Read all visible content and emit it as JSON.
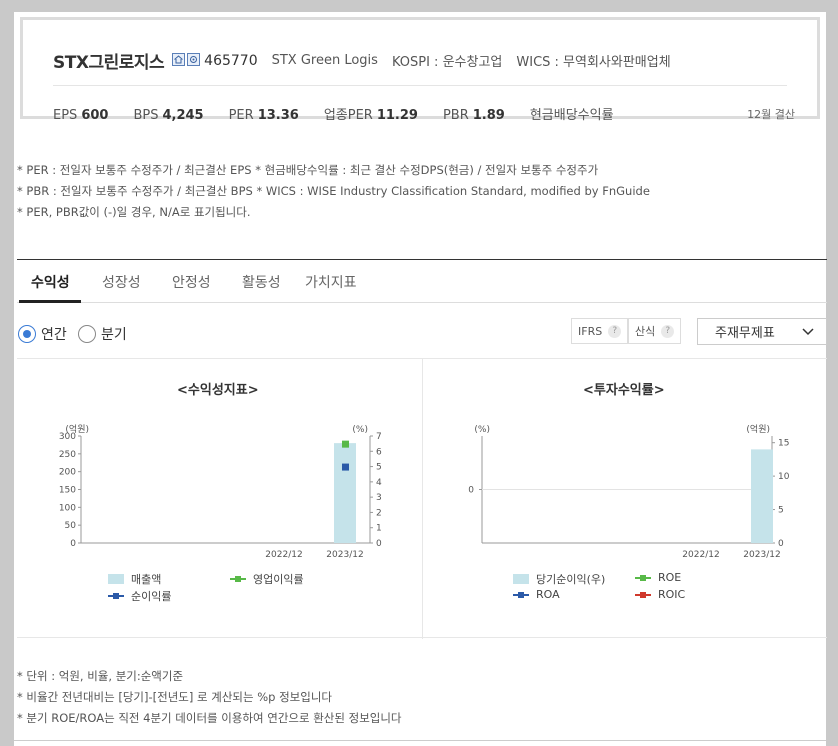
{
  "header": {
    "company": "STX그린로지스",
    "code": "465770",
    "english_name": "STX Green Logis",
    "market": "KOSPI : 운수창고업",
    "wics": "WICS : 무역회사와판매업체",
    "icons": [
      "home-icon",
      "ir-icon"
    ],
    "metrics": [
      {
        "label": "EPS",
        "value": "600"
      },
      {
        "label": "BPS",
        "value": "4,245"
      },
      {
        "label": "PER",
        "value": "13.36"
      },
      {
        "label": "업종PER",
        "value": "11.29"
      },
      {
        "label": "PBR",
        "value": "1.89"
      },
      {
        "label": "현금배당수익률",
        "value": ""
      }
    ],
    "fiscal": "12월 결산"
  },
  "notes_top": [
    "* PER : 전일자 보통주 수정주가 / 최근결산 EPS * 현금배당수익률 : 최근 결산 수정DPS(현금) / 전일자 보통주 수정주가",
    "* PBR : 전일자 보통주 수정주가 / 최근결산 BPS * WICS : WISE Industry Classification Standard, modified by FnGuide",
    "* PER, PBR값이 (-)일 경우, N/A로 표기됩니다."
  ],
  "tabs": [
    "수익성",
    "성장성",
    "안정성",
    "활동성",
    "가치지표"
  ],
  "period": {
    "annual": "연간",
    "quarter": "분기",
    "selected": "연간"
  },
  "controls": {
    "ifrs": "IFRS",
    "formula": "산식",
    "help": "?",
    "statement": "주재무제표"
  },
  "notes_bottom": [
    "* 단위 : 억원, 비율, 분기:순액기준",
    "* 비율간 전년대비는 [당기]-[전년도] 로 계산되는 %p 정보입니다",
    "* 분기 ROE/ROA는 직전 4분기 데이터를 이용하여 연간으로 환산된 정보입니다"
  ],
  "colors": {
    "bar": "#c5e3ea",
    "green": "#58b948",
    "blue": "#2b5aa8",
    "red": "#d0392c",
    "accent": "#3a7bd5"
  },
  "chart_data": [
    {
      "type": "bar",
      "title": "<수익성지표>",
      "left_unit": "(억원)",
      "right_unit": "(%)",
      "categories": [
        "2022/12",
        "2023/12"
      ],
      "left_ticks": [
        "300",
        "250",
        "200",
        "150",
        "100",
        "50",
        "0"
      ],
      "right_ticks": [
        "7",
        "6",
        "5",
        "4",
        "3",
        "2",
        "1",
        "0"
      ],
      "ylim_left": [
        0,
        300
      ],
      "ylim_right": [
        0,
        7
      ],
      "series": [
        {
          "name": "매출액",
          "axis": "left",
          "kind": "bar",
          "values": [
            null,
            280
          ]
        },
        {
          "name": "영업이익률",
          "axis": "right",
          "kind": "line",
          "values": [
            null,
            6.5
          ]
        },
        {
          "name": "순이익률",
          "axis": "right",
          "kind": "line",
          "values": [
            null,
            5.0
          ]
        }
      ]
    },
    {
      "type": "bar",
      "title": "<투자수익률>",
      "left_unit": "(%)",
      "right_unit": "(억원)",
      "categories": [
        "2022/12",
        "2023/12"
      ],
      "left_ticks": [
        "0"
      ],
      "right_ticks": [
        "15",
        "10",
        "5",
        "0"
      ],
      "ylim_right": [
        0,
        16
      ],
      "series": [
        {
          "name": "당기순이익(우)",
          "axis": "right",
          "kind": "bar",
          "values": [
            null,
            14
          ]
        },
        {
          "name": "ROE",
          "axis": "left",
          "kind": "line",
          "values": [
            null,
            null
          ]
        },
        {
          "name": "ROA",
          "axis": "left",
          "kind": "line",
          "values": [
            null,
            null
          ]
        },
        {
          "name": "ROIC",
          "axis": "left",
          "kind": "line",
          "values": [
            null,
            null
          ]
        }
      ]
    }
  ]
}
